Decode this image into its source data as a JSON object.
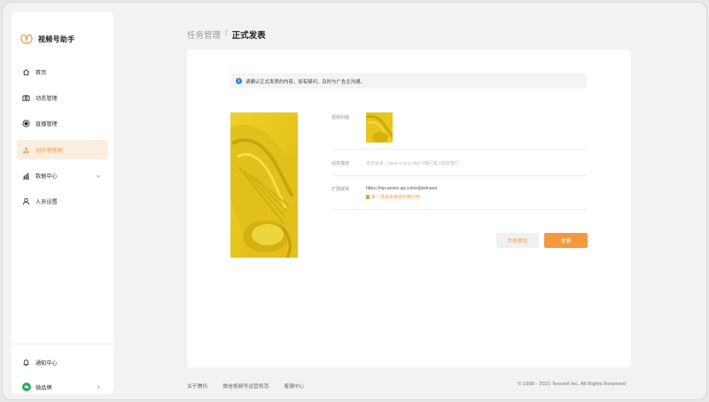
{
  "app": {
    "name": "视频号助手",
    "accent": "#f29b3e",
    "logo_icon": "butterfly-logo-icon"
  },
  "sidebar": {
    "items": [
      {
        "label": "首页",
        "icon": "home-icon"
      },
      {
        "label": "动态管理",
        "icon": "camera-icon"
      },
      {
        "label": "直播管理",
        "icon": "live-record-icon"
      },
      {
        "label": "创作者营地",
        "icon": "campfire-icon",
        "active": true
      },
      {
        "label": "数据中心",
        "icon": "bar-chart-icon",
        "expandable": true
      },
      {
        "label": "人员设置",
        "icon": "user-icon"
      }
    ],
    "bottom": [
      {
        "label": "通知中心",
        "icon": "bell-icon"
      },
      {
        "label": "微品牌",
        "icon": "brand-badge-icon",
        "expandable": true
      }
    ]
  },
  "breadcrumb": {
    "parent": "任务管理",
    "separator": "/",
    "current": "正式发表"
  },
  "notice": {
    "text": "请确认正式发表的内容，如有疑问，及时与广告主沟通。",
    "icon": "info-icon"
  },
  "form": {
    "cover_label": "视频封面",
    "desc_label": "动态描述",
    "desc_value": "说走就走，have a nice day! #旅行季 #说走旅行",
    "link_label": "扩展链接",
    "link_url": "https://mp.weixin.qq.com/s/jiketravel",
    "link_sub": "来一场说走就走的旅行吧"
  },
  "actions": {
    "preview_label": "手机预览",
    "publish_label": "发表"
  },
  "footer": {
    "links": [
      "关于腾讯",
      "微信视频号运营规范",
      "客服中心"
    ],
    "copyright": "© 1998 - 2021 Tencent Inc. All Rights Reserved"
  }
}
